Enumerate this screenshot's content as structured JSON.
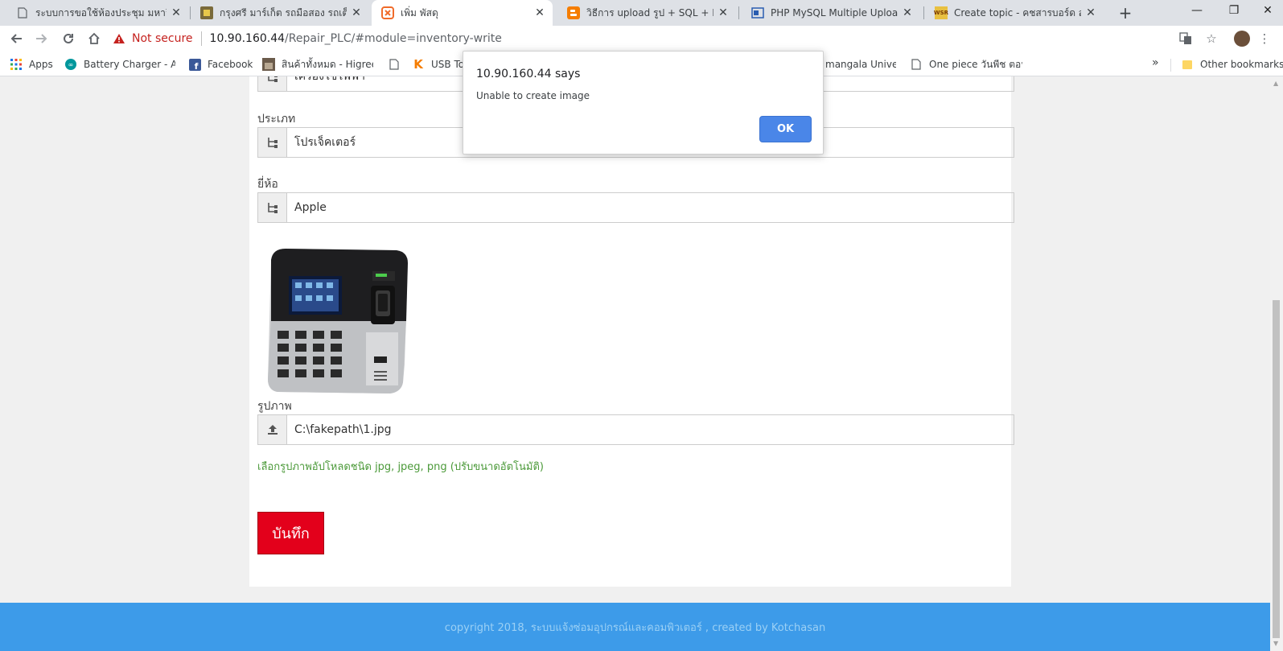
{
  "browser": {
    "tabs": [
      {
        "title": "ระบบการขอใช้ห้องประชุม มหาวิทยาลัย",
        "favicon": "page-icon"
      },
      {
        "title": "กรุงศรี มาร์เก็ต รถมือสอง รถเต็นท์ รถ",
        "favicon": "krungsri-icon"
      },
      {
        "title": "เพิ่ม พัสดุ",
        "favicon": "xampp-icon"
      },
      {
        "title": "วิธีการ upload รูป + SQL + Resize",
        "favicon": "blogger-icon"
      },
      {
        "title": "PHP MySQL Multiple Upload File",
        "favicon": "site-icon"
      },
      {
        "title": "Create topic - คชสารบอร์ด สำหรับ",
        "favicon": "wsr-icon"
      }
    ],
    "favicon_text": {
      "wsr": "WSR"
    },
    "toolbar": {
      "security_label": "Not secure",
      "url_host": "10.90.160.44",
      "url_path": "/Repair_PLC/#module=inventory-write"
    },
    "bookmarks": [
      {
        "label": "Apps",
        "icon": "apps-grid-icon"
      },
      {
        "label": "Battery Charger - Ard",
        "icon": "arduino-icon"
      },
      {
        "label": "Facebook",
        "icon": "facebook-icon"
      },
      {
        "label": "สินค้าทั้งหมด - Higreen",
        "icon": "higreen-icon"
      },
      {
        "label": "",
        "icon": "page-icon"
      },
      {
        "label": "USB To",
        "icon": "k-icon"
      },
      {
        "label": "mangala Univers",
        "icon": ""
      },
      {
        "label": "One piece วันพีช ตอนที่",
        "icon": "page-icon"
      }
    ],
    "bookmark_k": "K",
    "other_bookmarks": "Other bookmarks"
  },
  "form": {
    "top_field_value": "เครื่องใช้ไฟฟ้า",
    "type_label": "ประเภท",
    "type_value": "โปรเจ็คเตอร์",
    "brand_label": "ยี่ห้อ",
    "brand_value": "Apple",
    "image_label": "รูปภาพ",
    "image_value": "C:\\fakepath\\1.jpg",
    "image_hint": "เลือกรูปภาพอัปโหลดชนิด jpg, jpeg, png (ปรับขนาดอัตโนมัติ)",
    "save_label": "บันทึก"
  },
  "footer": {
    "text": "copyright 2018, ระบบแจ้งซ่อมอุปกรณ์และคอมพิวเตอร์ , created by Kotchasan"
  },
  "alert": {
    "title": "10.90.160.44 says",
    "message": "Unable to create image",
    "ok_label": "OK"
  },
  "colors": {
    "save_button": "#e3001b",
    "footer_bg": "#3d9be9",
    "hint_text": "#4c9a3a",
    "alert_ok": "#4a86e8",
    "not_secure": "#c5221f"
  }
}
